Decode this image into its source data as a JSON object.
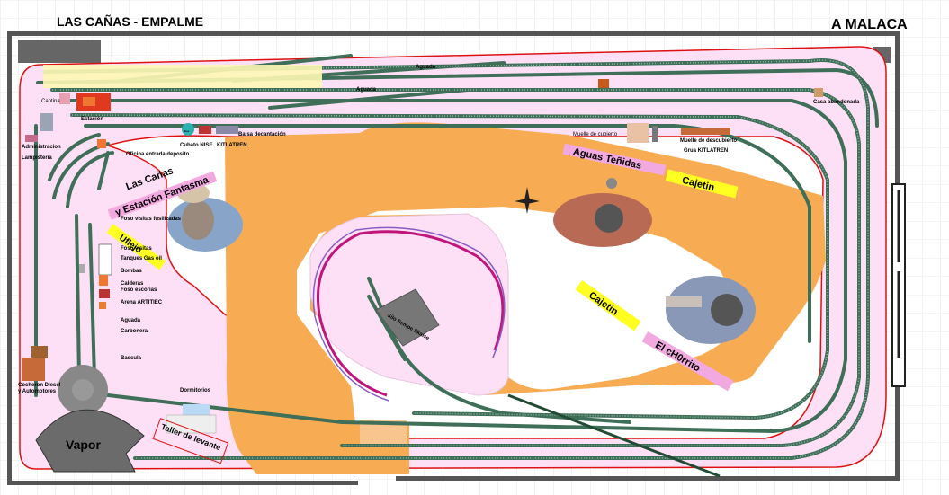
{
  "header": {
    "left_title": "LAS CAÑAS - EMPALME",
    "right_title": "A MALACA"
  },
  "labels": {
    "aguada_1": "Aguada",
    "aguada_2": "Aguada",
    "aguada_3": "Aguada",
    "cantina": "Cantina",
    "estacion": "Estación",
    "administracion": "Administracion",
    "lampisteria": "Lampisteria",
    "oficina_deposito": "Oficina entrada deposito",
    "cubato": "Cubato NISE",
    "kitlatren_1": "KITLATREN",
    "balsa": "Balsa decantación",
    "muelle_cubierto": "Muelle de cubierto",
    "muelle_descubierto": "Muelle de descubierto",
    "grua": "Grua KITLATREN",
    "casa_abandonada": "Casa abandonada",
    "foso_visitas_fusilizadas": "Foso visitas fusilizadas",
    "foso_visitas": "Foso visitas",
    "tanques": "Tanques Gas oil",
    "bombas": "Bombas",
    "calderas": "Calderas",
    "foso_escorias": "Foso escorias",
    "arena": "Arena ARTITIEC",
    "carbonera": "Carbonera",
    "bascula": "Bascula",
    "cocheron": "Cocheron Diesel",
    "automotores": "y Automotores",
    "dormitorios": "Dormitorios",
    "vapor": "Vapor",
    "taller": "Taller de levante",
    "silo": "Silo Sempe Skaise",
    "nise_tag": "Nise"
  },
  "banners": {
    "fantasma_1": "Las Cañas",
    "fantasma_2": "y Estación Fantasma",
    "fantasma_yellow": "Uflejo",
    "aguas": "Aguas Teñidas",
    "cajetin_1": "Cajetin",
    "cajetin_2": "Cajetin",
    "churrito": "El cH0rrito"
  },
  "colors": {
    "track": "#3f6f58",
    "tie": "#8fb3a3",
    "baseboard_pink": "#fde0f6",
    "terrain_orange": "#f7ac54",
    "frame": "#555555",
    "red_line": "#dd1111",
    "banner_pink": "#f2a9e0",
    "banner_yellow": "#ffff22"
  }
}
